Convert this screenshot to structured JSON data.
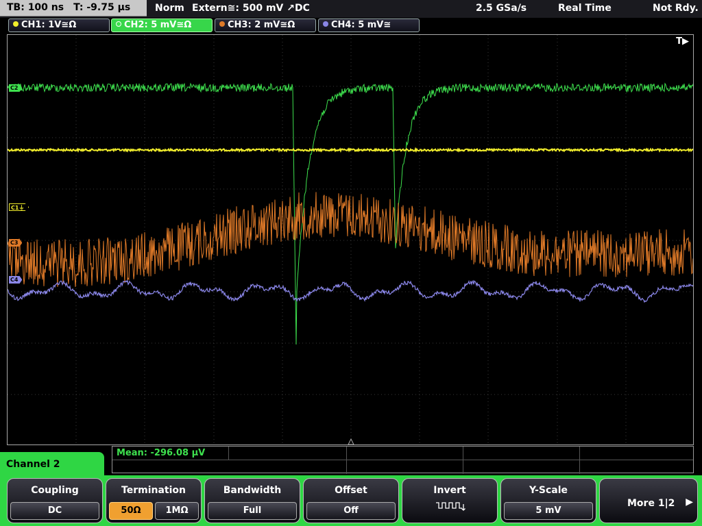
{
  "topbar": {
    "timebase": "TB: 100 ns",
    "trigger_time": "T: -9.75 µs",
    "trigger_mode": "Norm",
    "trigger_source": "Extern≅: 500 mV ↗DC",
    "sample_rate": "2.5 GSa/s",
    "acq_mode": "Real Time",
    "status": "Not Rdy."
  },
  "channels": [
    {
      "label": "CH1: 1V≅Ω",
      "color": "#f2ee2c"
    },
    {
      "label": "CH2: 5 mV≅Ω",
      "color": "#3ee14e"
    },
    {
      "label": "CH3: 2 mV≅Ω",
      "color": "#e07a28"
    },
    {
      "label": "CH4: 5 mV≅",
      "color": "#8a86e8"
    }
  ],
  "plot": {
    "trigger_marker": "T▶",
    "markers": {
      "c2": "C2",
      "c1": "C1⏚",
      "c3": "C3",
      "c4": "C4"
    }
  },
  "measurement": {
    "mean": "Mean: -296.08 µV"
  },
  "menu": {
    "title": "Channel 2",
    "coupling": {
      "title": "Coupling",
      "value": "DC"
    },
    "termination": {
      "title": "Termination",
      "opt1": "50Ω",
      "opt2": "1MΩ"
    },
    "bandwidth": {
      "title": "Bandwidth",
      "value": "Full"
    },
    "offset": {
      "title": "Offset",
      "value": "Off"
    },
    "invert": {
      "title": "Invert"
    },
    "yscale": {
      "title": "Y-Scale",
      "value": "5 mV"
    },
    "more": {
      "label": "More 1|2"
    }
  }
}
